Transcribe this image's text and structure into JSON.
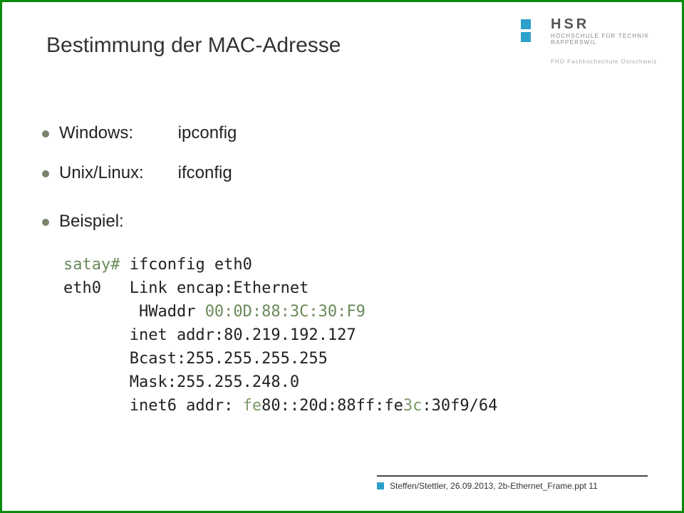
{
  "logo": {
    "abbr": "HSR",
    "line1": "HOCHSCHULE FÜR TECHNIK",
    "line2": "RAPPERSWIL",
    "line3": "FHO Fachhochschule Ostschweiz"
  },
  "title": "Bestimmung der MAC-Adresse",
  "bullets": {
    "windows_label": "Windows:",
    "windows_cmd": "ipconfig",
    "unix_label": "Unix/Linux:",
    "unix_cmd": "ifconfig",
    "example_label": "Beispiel:"
  },
  "code": {
    "prompt": "satay#",
    "cmd": " ifconfig eth0",
    "l2": "eth0   Link encap:Ethernet",
    "l3a": "        HWaddr ",
    "mac": "00:0D:88:3C:30:F9",
    "l4": "       inet addr:80.219.192.127",
    "l5": "       Bcast:255.255.255.255",
    "l6": "       Mask:255.255.248.0",
    "l7a": "       inet6 addr: ",
    "ip6a": "fe",
    "l7b": "80::20d:88ff:fe",
    "ip6b": "3c",
    "l7c": ":30f9",
    "l7d": "/64"
  },
  "footer": "Steffen/Stettler, 26.09.2013, 2b-Ethernet_Frame.ppt 11"
}
